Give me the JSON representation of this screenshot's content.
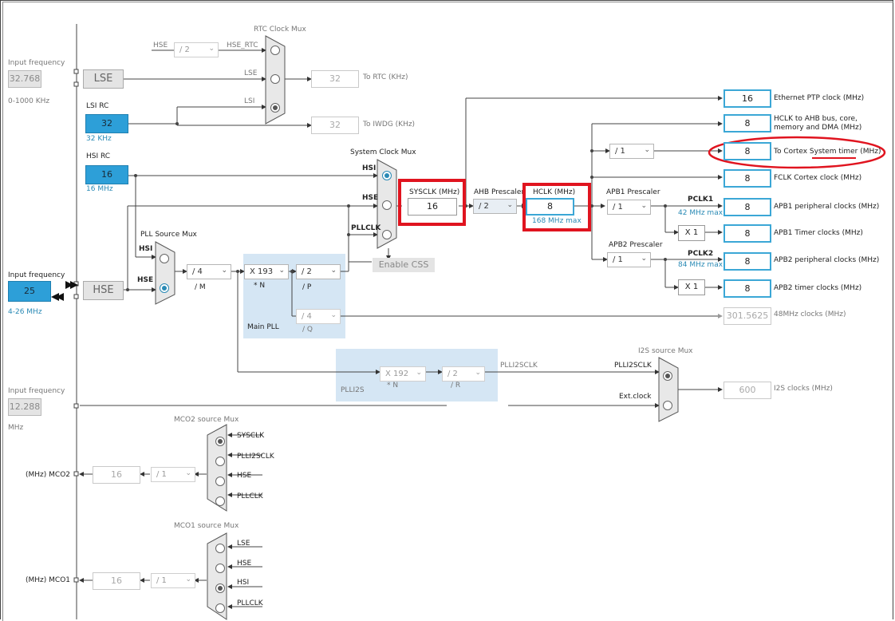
{
  "rtc_clock_mux": "RTC Clock Mux",
  "system_clock_mux": "System Clock Mux",
  "pll_source_mux": "PLL Source Mux",
  "i2s_source_mux": "I2S source Mux",
  "mco2_source_mux": "MCO2 source Mux",
  "mco1_source_mux": "MCO1 source Mux",
  "lse": {
    "freq_label": "Input frequency",
    "value": "32.768",
    "range": "0-1000 KHz",
    "name": "LSE"
  },
  "lsi": {
    "name": "LSI RC",
    "value": "32",
    "unit": "32 KHz"
  },
  "hsi": {
    "name": "HSI RC",
    "value": "16",
    "unit": "16 MHz"
  },
  "hse": {
    "freq_label": "Input frequency",
    "value": "25",
    "range": "4-26 MHz",
    "name": "HSE"
  },
  "i2s_ext": {
    "freq_label": "Input frequency",
    "value": "12.288",
    "unit": "MHz"
  },
  "rtc": {
    "hse_div": "/ 2",
    "hse_rtc": "HSE_RTC",
    "lse": "LSE",
    "lsi": "LSI",
    "hse_in": "HSE",
    "rtc_value": "32",
    "rtc_label": "To RTC (KHz)",
    "iwdg_value": "32",
    "iwdg_label": "To IWDG (KHz)"
  },
  "sysmux": {
    "hsi": "HSI",
    "hse": "HSE",
    "pllclk": "PLLCLK",
    "enable_css": "Enable CSS"
  },
  "pllmux": {
    "hsi": "HSI",
    "hse": "HSE"
  },
  "pll": {
    "div_m": "/ 4",
    "m_label": "/ M",
    "mul_n": "X 193",
    "n_label": "* N",
    "div_p": "/ 2",
    "p_label": "/ P",
    "div_q": "/ 4",
    "q_label": "/ Q",
    "name": "Main PLL"
  },
  "plli2s": {
    "name": "PLLI2S",
    "mul_n": "X 192",
    "n_label": "* N",
    "div_r": "/ 2",
    "r_label": "/ R",
    "out": "PLLI2SCLK"
  },
  "sysclk": {
    "label": "SYSCLK (MHz)",
    "value": "16"
  },
  "ahb": {
    "label": "AHB Prescaler",
    "value": "/ 2"
  },
  "hclk": {
    "label": "HCLK (MHz)",
    "value": "8",
    "max": "168 MHz max"
  },
  "apb1": {
    "label": "APB1 Prescaler",
    "value": "/ 1",
    "pclk": "PCLK1",
    "max": "42 MHz max",
    "timer_mul": "X 1"
  },
  "apb2": {
    "label": "APB2 Prescaler",
    "value": "/ 1",
    "pclk": "PCLK2",
    "max": "84 MHz max",
    "timer_mul": "X 1"
  },
  "cortex_div": "/ 1",
  "outputs": {
    "eth": {
      "value": "16",
      "label": "Ethernet PTP clock (MHz)"
    },
    "hclk_ahb": {
      "value": "8",
      "label1": "HCLK to AHB bus, core,",
      "label2": "memory and DMA (MHz)"
    },
    "cortex": {
      "value": "8",
      "label": "To Cortex System timer (MHz)"
    },
    "fclk": {
      "value": "8",
      "label": "FCLK Cortex clock (MHz)"
    },
    "apb1_periph": {
      "value": "8",
      "label": "APB1 peripheral clocks (MHz)"
    },
    "apb1_timer": {
      "value": "8",
      "label": "APB1 Timer clocks (MHz)"
    },
    "apb2_periph": {
      "value": "8",
      "label": "APB2 peripheral clocks (MHz)"
    },
    "apb2_timer": {
      "value": "8",
      "label": "APB2 timer clocks (MHz)"
    },
    "usb48": {
      "value": "301.5625",
      "label": "48MHz clocks (MHz)"
    },
    "i2s": {
      "value": "600",
      "label": "I2S clocks (MHz)"
    }
  },
  "i2smux": {
    "plli2sclk": "PLLI2SCLK",
    "ext": "Ext.clock"
  },
  "mco2": {
    "label": "(MHz) MCO2",
    "value": "16",
    "div": "/ 1",
    "sysclk": "SYSCLK",
    "plli2sclk": "PLLI2SCLK",
    "hse": "HSE",
    "pllclk": "PLLCLK"
  },
  "mco1": {
    "label": "(MHz) MCO1",
    "value": "16",
    "div": "/ 1",
    "lse": "LSE",
    "hse": "HSE",
    "hsi": "HSI",
    "pllclk": "PLLCLK"
  },
  "colors": {
    "accent_blue": "#2d9fd8",
    "highlight_red": "#e0141f",
    "pll_bg": "#d5e6f4"
  }
}
